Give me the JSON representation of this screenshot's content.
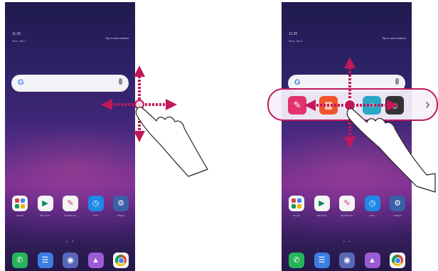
{
  "screens": [
    {
      "status": {
        "clock": "11:20",
        "date": "Mon, Jan 1",
        "weather": "Tap to add weather"
      },
      "search": {
        "logo": "G"
      },
      "apps": [
        {
          "icon": "google-folder-icon",
          "label": "Google"
        },
        {
          "icon": "play-store-icon",
          "label": "Play Store"
        },
        {
          "icon": "quickmemo-icon",
          "label": "QuickMemo+"
        },
        {
          "icon": "clock-icon",
          "label": "Clock"
        },
        {
          "icon": "settings-icon",
          "label": "Settings"
        }
      ],
      "page_indicator": "⌂ •",
      "dock": [
        {
          "icon": "phone-icon"
        },
        {
          "icon": "messages-icon"
        },
        {
          "icon": "camera-icon"
        },
        {
          "icon": "gallery-icon"
        },
        {
          "icon": "chrome-icon"
        }
      ]
    },
    {
      "status": {
        "clock": "11:20",
        "date": "Mon, Jan 1",
        "weather": "Tap to add weather"
      },
      "search": {
        "logo": "G"
      },
      "apps": [
        {
          "icon": "google-folder-icon",
          "label": "Google"
        },
        {
          "icon": "play-store-icon",
          "label": "Play Store"
        },
        {
          "icon": "quickmemo-icon",
          "label": "QuickMemo+"
        },
        {
          "icon": "clock-icon",
          "label": "Clock"
        },
        {
          "icon": "settings-icon",
          "label": "Settings"
        }
      ],
      "page_indicator": "⌂ •",
      "dock": [
        {
          "icon": "phone-icon"
        },
        {
          "icon": "messages-icon"
        },
        {
          "icon": "camera-icon"
        },
        {
          "icon": "gallery-icon"
        },
        {
          "icon": "chrome-icon"
        }
      ]
    }
  ],
  "shortcut_panel": {
    "items": [
      "memo-icon",
      "calendar-icon",
      "capture-icon",
      "camera-switch-icon"
    ],
    "chevron": "›",
    "border_color": "#c2185b"
  },
  "colors": {
    "arrow": "#c2185b",
    "touch_point": "#c2185b"
  }
}
